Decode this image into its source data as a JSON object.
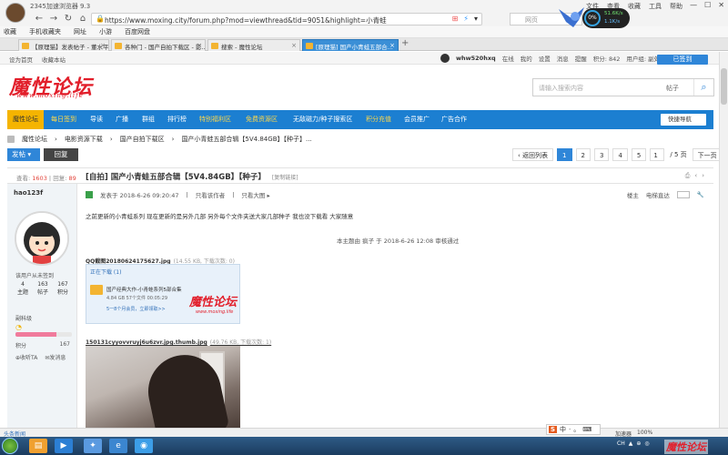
{
  "browser": {
    "title": "2345加速浏览器 9.3",
    "menus": [
      "文件",
      "查看",
      "收藏",
      "工具",
      "帮助"
    ],
    "url": "https://www.moxing.city/forum.php?mod=viewthread&tid=9051&highlight=小青蛙",
    "search_placeholder": "网页",
    "speed_value": "0%",
    "speed_up": "51.6K/s",
    "speed_down": "1.1K/s",
    "bookmarks": [
      "收藏",
      "手机收藏夹",
      "网址",
      "小游",
      "百度网盘"
    ],
    "tabs": [
      {
        "label": "【原理猫】发表帖子 - 董水平..."
      },
      {
        "label": "各种门 - 国产自拍下载区 - 影..."
      },
      {
        "label": "搜索 - 魔性论坛"
      },
      {
        "label": "[原理猫] 国产小青蛙五部合..."
      }
    ],
    "new_tab": "+"
  },
  "site_top": {
    "left_links": [
      "设为首页",
      "收藏本站"
    ],
    "username": "whw520hxq",
    "status": "在线",
    "links": [
      "我的",
      "设置",
      "消息",
      "提醒",
      "积分: 842",
      "用户组: 副处级",
      "退出"
    ],
    "vip_label": "已签到"
  },
  "header": {
    "logo": "魔性论坛",
    "logo_sub": "www.moxing.life",
    "search_placeholder": "请输入搜索内容",
    "search_type": "帖子",
    "search_icon": "search-icon"
  },
  "nav": {
    "items": [
      {
        "label": "魔性论坛",
        "style": "home"
      },
      {
        "label": "每日签到",
        "style": "hl"
      },
      {
        "label": "导读",
        "style": ""
      },
      {
        "label": "广播",
        "style": ""
      },
      {
        "label": "群组",
        "style": ""
      },
      {
        "label": "排行榜",
        "style": ""
      },
      {
        "label": "特别福利区",
        "style": "hl"
      },
      {
        "label": "免费资源区",
        "style": "hl"
      },
      {
        "label": "无敌磁力/种子搜索区",
        "style": ""
      },
      {
        "label": "积分充值",
        "style": "hl"
      },
      {
        "label": "会员推广",
        "style": ""
      },
      {
        "label": "广告合作",
        "style": ""
      }
    ],
    "quick_nav": "快捷导航"
  },
  "breadcrumb": [
    "魔性论坛",
    "电影资源下载",
    "国产自拍下载区",
    "国产小青蛙五部合辑【5V4.84GB】【种子】..."
  ],
  "actions": {
    "post_label": "发帖",
    "reply_label": "回复"
  },
  "pager": {
    "back_label": "返回列表",
    "pages": [
      "1",
      "2",
      "3",
      "4",
      "5"
    ],
    "current": "1",
    "input_value": "1",
    "total": "/ 5 页",
    "next": "下一页"
  },
  "thread": {
    "views_label": "查看:",
    "views": "1603",
    "replies_label": "回复:",
    "replies": "89",
    "category": "[自拍]",
    "title": "国产小青蛙五部合辑【5V4.84GB】【种子】",
    "copy_link": "[复制链接]",
    "icons": [
      "print-icon",
      "prev-icon",
      "next-icon"
    ]
  },
  "author": {
    "name": "hao123f",
    "status": "该用户从未签到",
    "stats": [
      {
        "value": "4",
        "label": "主题"
      },
      {
        "value": "163",
        "label": "帖子"
      },
      {
        "value": "167",
        "label": "积分"
      }
    ],
    "level": "副科级",
    "level_progress": 0.72,
    "points_label": "积分",
    "points": "167",
    "actions": [
      "收听TA",
      "发消息"
    ]
  },
  "post": {
    "meta_prefix": "发表于",
    "date": "2018-6-26 09:20:47",
    "only_author": "只看该作者",
    "only_big": "只看大图",
    "floor_label": "楼主",
    "jump_label": "电梯直达",
    "body": "之前更新的小青蛙系列 现在更新的是另外几部 另外每个文件夹送大家几部种子 我也没下载看 大家随意",
    "edit_note": "本主题由 疯子 于 2018-6-26 12:08 审核通过",
    "attachment1": {
      "name": "QQ截图20180624175627.jpg",
      "meta": "(14.55 KB, 下载次数: 0)",
      "header": "正在下载 (1)",
      "file_name": "国产经典大作-小青蛙系列5部合集",
      "file_size": "4.84 GB  57个文件",
      "file_progress": "00:05:29",
      "more": "5一8个月会员，立即领取>>",
      "watermark": "魔性论坛",
      "watermark_sub": "www.moxing.life"
    },
    "attachment2": {
      "name": "150131cyyovvruyj6u6zvr.jpg.thumb.jpg",
      "meta": "(49.76 KB, 下载次数: 1)"
    }
  },
  "statusbar": {
    "news": "头条新闻",
    "right": [
      "加速器",
      "100%"
    ]
  },
  "ime": {
    "logo": "S",
    "items": [
      "中",
      "·",
      "。"
    ]
  },
  "tray": [
    "CH",
    "▲",
    "⊕",
    "◎"
  ],
  "tray_logo": "魔性论坛"
}
